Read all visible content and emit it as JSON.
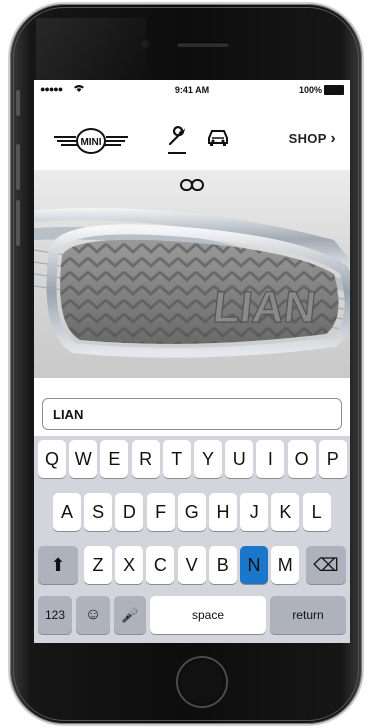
{
  "status_bar": {
    "time": "9:41 AM",
    "battery": "100%",
    "signal": "●●●●●"
  },
  "header": {
    "logo_text": "MINI",
    "shop_label": "SHOP",
    "shop_chevron": "›"
  },
  "hero": {
    "grille_text": "LIAN"
  },
  "name_input": {
    "value": "LIAN"
  },
  "keyboard": {
    "row1": [
      "Q",
      "W",
      "E",
      "R",
      "T",
      "Y",
      "U",
      "I",
      "O",
      "P"
    ],
    "row2": [
      "A",
      "S",
      "D",
      "F",
      "G",
      "H",
      "J",
      "K",
      "L"
    ],
    "row3": [
      "Z",
      "X",
      "C",
      "V",
      "B",
      "N",
      "M"
    ],
    "active_key": "N",
    "numbers_label": "123",
    "space_label": "space",
    "return_label": "return",
    "shift_symbol": "⬆",
    "delete_symbol": "⌫",
    "emoji_symbol": "☺",
    "mic_symbol": "🎤"
  },
  "colors": {
    "active_key": "#1b77c9",
    "keyboard_bg": "#d2d5db"
  }
}
